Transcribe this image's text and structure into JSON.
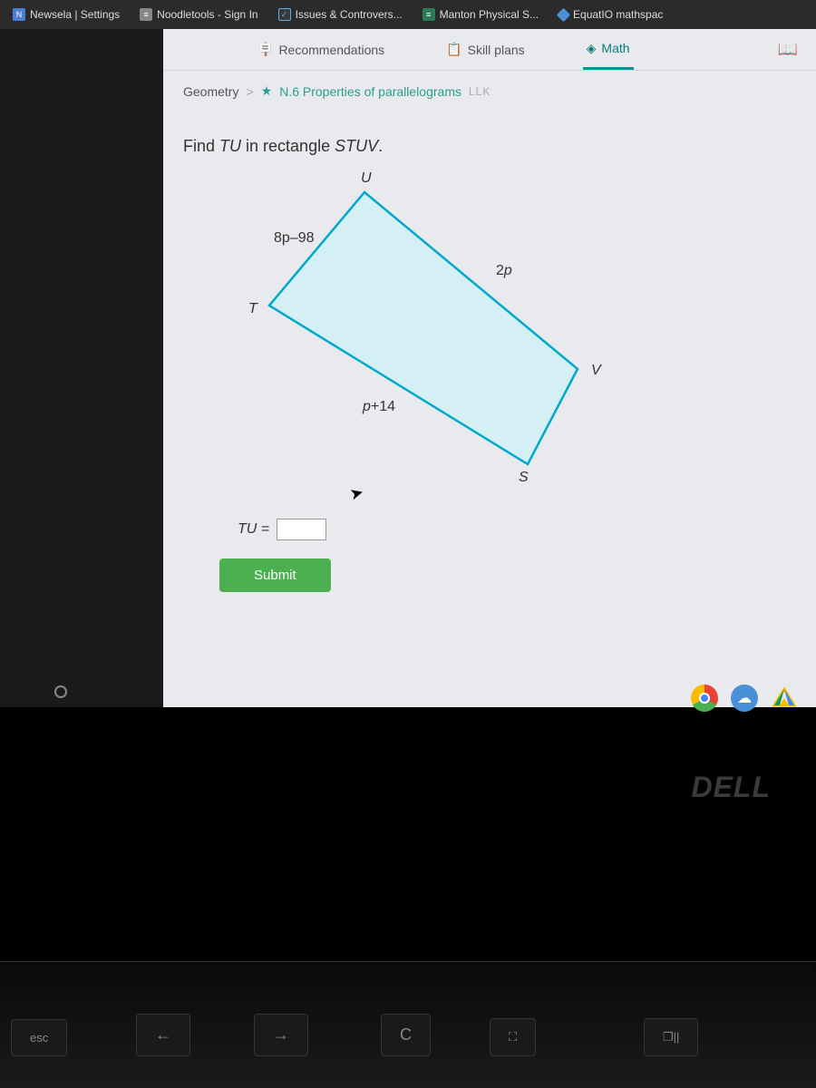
{
  "browser": {
    "tabs": [
      {
        "label": "Newsela | Settings"
      },
      {
        "label": "Noodletools - Sign In"
      },
      {
        "label": "Issues & Controvers..."
      },
      {
        "label": "Manton Physical S..."
      },
      {
        "label": "EquatIO mathspac"
      }
    ]
  },
  "nav": {
    "recommendations": "Recommendations",
    "skill_plans": "Skill plans",
    "math": "Math"
  },
  "breadcrumb": {
    "subject": "Geometry",
    "separator": ">",
    "skill": "N.6 Properties of parallelograms",
    "level": "LLK"
  },
  "question": {
    "prefix": "Find ",
    "segment": "TU",
    "middle": " in rectangle ",
    "shape": "STUV",
    "suffix": "."
  },
  "diagram": {
    "vertices": {
      "U": "U",
      "T": "T",
      "V": "V",
      "S": "S"
    },
    "sides": {
      "TU": "8p–98",
      "UV": "2p",
      "TS": "p+14"
    }
  },
  "answer": {
    "label": "TU =",
    "value": ""
  },
  "submit_label": "Submit",
  "keys": {
    "esc": "esc",
    "back": "←",
    "forward": "→",
    "refresh": "C",
    "full": "⛶",
    "overview": "❐||"
  },
  "logo": "DELL"
}
